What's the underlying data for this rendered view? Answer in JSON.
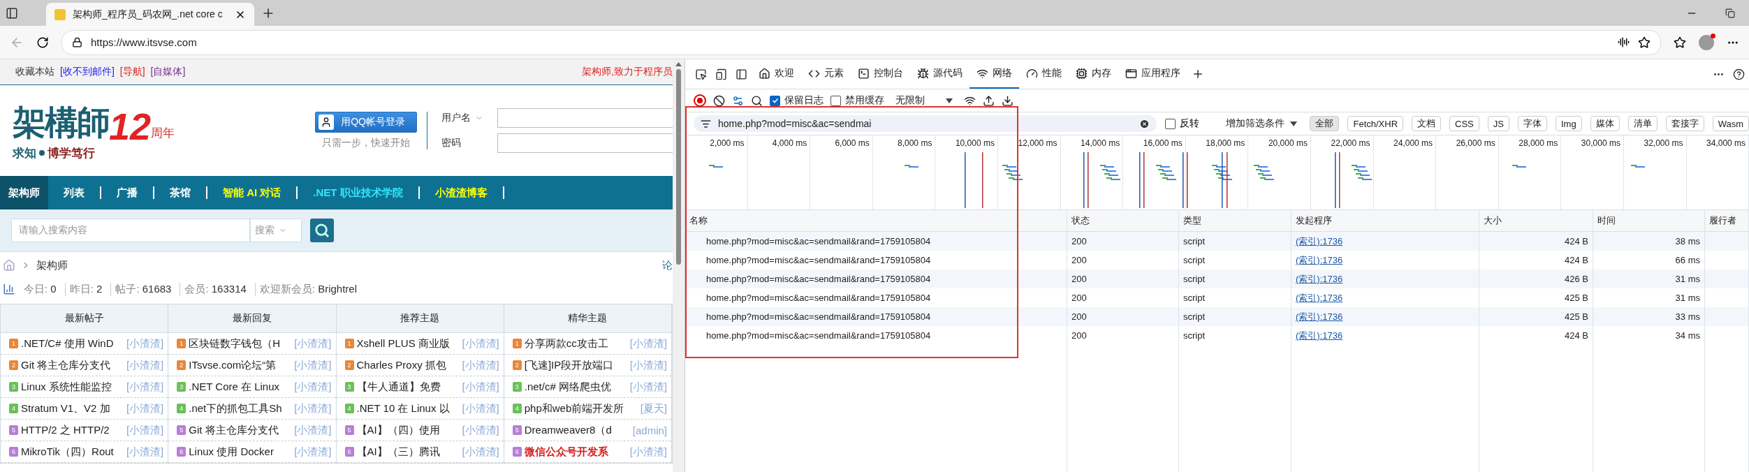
{
  "browser": {
    "tab_title": "架构师_程序员_码农网_.net core c",
    "url": "https://www.itsvse.com"
  },
  "site": {
    "top_links": [
      {
        "text": "收藏本站",
        "color": "#333333"
      },
      {
        "text": "[收不到邮件]",
        "color": "#1a1aee"
      },
      {
        "text": "[导航]",
        "color": "#e02020"
      },
      {
        "text": "[自媒体]",
        "color": "#7a2a8a"
      }
    ],
    "slogan": "架构师,致力于程序员",
    "logo": {
      "name": "架構師",
      "number": "12",
      "suffix": "周年",
      "motto_1": "求知",
      "motto_2": "博学笃行"
    },
    "qq_login": "用QQ帐号登录",
    "qq_hint": "只需一步，快速开始",
    "login_fields": [
      {
        "label": "用户名",
        "dropdown": true
      },
      {
        "label": "密码",
        "dropdown": false
      }
    ],
    "nav": [
      {
        "label": "架构师",
        "selected": true,
        "color": "#ffffff"
      },
      {
        "label": "列表",
        "selected": false,
        "color": "#ffffff"
      },
      {
        "label": "广播",
        "selected": false,
        "color": "#ffffff"
      },
      {
        "label": "茶馆",
        "selected": false,
        "color": "#ffffff"
      },
      {
        "label": "智能 AI 对话",
        "selected": false,
        "color": "#ffff00"
      },
      {
        "label": ".NET 职业技术学院",
        "selected": false,
        "color": "#33e6ff"
      },
      {
        "label": "小渣渣博客",
        "selected": false,
        "color": "#ffff00"
      }
    ],
    "search": {
      "placeholder": "请输入搜索内容",
      "scope": "搜索"
    },
    "breadcrumb": "架构师",
    "breadcrumb_right": "论",
    "stats": [
      {
        "label": "今日:",
        "value": "0"
      },
      {
        "label": "昨日:",
        "value": "2"
      },
      {
        "label": "帖子:",
        "value": "61683"
      },
      {
        "label": "会员:",
        "value": "163314"
      },
      {
        "label": "欢迎新会员:",
        "value": "Brightrel"
      }
    ],
    "columns": [
      {
        "title": "最新帖子",
        "items": [
          {
            "rank": "1",
            "color": "#e8873a",
            "title": ".NET/C# 使用 WinD",
            "author": "[小渣渣]",
            "emphasis": false
          },
          {
            "rank": "2",
            "color": "#e8873a",
            "title": "Git 将主仓库分支代",
            "author": "[小渣渣]",
            "emphasis": false
          },
          {
            "rank": "3",
            "color": "#6cbf5a",
            "title": "Linux 系统性能监控",
            "author": "[小渣渣]",
            "emphasis": false
          },
          {
            "rank": "4",
            "color": "#6cbf5a",
            "title": "Stratum V1、V2 加",
            "author": "[小渣渣]",
            "emphasis": false
          },
          {
            "rank": "5",
            "color": "#b77ed6",
            "title": "HTTP/2 之 HTTP/2",
            "author": "[小渣渣]",
            "emphasis": false
          },
          {
            "rank": "6",
            "color": "#b77ed6",
            "title": "MikroTik（四）Rout",
            "author": "[小渣渣]",
            "emphasis": false
          }
        ]
      },
      {
        "title": "最新回复",
        "items": [
          {
            "rank": "1",
            "color": "#e8873a",
            "title": "区块链数字钱包（H",
            "author": "[小渣渣]",
            "emphasis": false
          },
          {
            "rank": "2",
            "color": "#e8873a",
            "title": "ITsvse.com论坛“第",
            "author": "[小渣渣]",
            "emphasis": false
          },
          {
            "rank": "3",
            "color": "#6cbf5a",
            "title": ".NET Core 在 Linux",
            "author": "[小渣渣]",
            "emphasis": false
          },
          {
            "rank": "4",
            "color": "#6cbf5a",
            "title": ".net下的抓包工具Sh",
            "author": "[小渣渣]",
            "emphasis": false
          },
          {
            "rank": "5",
            "color": "#b77ed6",
            "title": "Git 将主仓库分支代",
            "author": "[小渣渣]",
            "emphasis": false
          },
          {
            "rank": "6",
            "color": "#b77ed6",
            "title": "Linux 使用 Docker",
            "author": "[小渣渣]",
            "emphasis": false
          }
        ]
      },
      {
        "title": "推荐主题",
        "items": [
          {
            "rank": "1",
            "color": "#e8873a",
            "title": "Xshell PLUS 商业版",
            "author": "[小渣渣]",
            "emphasis": false
          },
          {
            "rank": "2",
            "color": "#e8873a",
            "title": "Charles Proxy 抓包",
            "author": "[小渣渣]",
            "emphasis": false
          },
          {
            "rank": "3",
            "color": "#6cbf5a",
            "title": "【牛人通道】免费",
            "author": "[小渣渣]",
            "emphasis": false
          },
          {
            "rank": "4",
            "color": "#6cbf5a",
            "title": ".NET 10 在 Linux 以",
            "author": "[小渣渣]",
            "emphasis": false
          },
          {
            "rank": "5",
            "color": "#b77ed6",
            "title": "【AI】（四）使用",
            "author": "[小渣渣]",
            "emphasis": false
          },
          {
            "rank": "6",
            "color": "#b77ed6",
            "title": "【AI】（三）腾讯",
            "author": "[小渣渣]",
            "emphasis": false
          }
        ]
      },
      {
        "title": "精华主题",
        "items": [
          {
            "rank": "1",
            "color": "#e8873a",
            "title": "分享两款cc攻击工",
            "author": "[小渣渣]",
            "emphasis": false
          },
          {
            "rank": "2",
            "color": "#e8873a",
            "title": "[飞速]IP段开放端口",
            "author": "[小渣渣]",
            "emphasis": false
          },
          {
            "rank": "3",
            "color": "#6cbf5a",
            "title": ".net/c# 网络爬虫优",
            "author": "[小渣渣]",
            "emphasis": false
          },
          {
            "rank": "4",
            "color": "#6cbf5a",
            "title": "php和web前端开发所",
            "author": "[夏天]",
            "emphasis": false
          },
          {
            "rank": "5",
            "color": "#b77ed6",
            "title": "Dreamweaver8（d",
            "author": "[admin]",
            "emphasis": false
          },
          {
            "rank": "6",
            "color": "#b77ed6",
            "title": "微信公众号开发系",
            "author": "[小渣渣]",
            "emphasis": true
          }
        ]
      }
    ]
  },
  "devtools": {
    "tabs": [
      {
        "label": "欢迎",
        "kind": "home",
        "selected": false
      },
      {
        "label": "元素",
        "kind": "code",
        "selected": false
      },
      {
        "label": "控制台",
        "kind": "console",
        "selected": false
      },
      {
        "label": "源代码",
        "kind": "bug",
        "selected": false
      },
      {
        "label": "网络",
        "kind": "wifi",
        "selected": true
      },
      {
        "label": "性能",
        "kind": "gauge",
        "selected": false
      },
      {
        "label": "内存",
        "kind": "chip",
        "selected": false
      },
      {
        "label": "应用程序",
        "kind": "window",
        "selected": false
      }
    ],
    "preserve_log": {
      "label": "保留日志",
      "checked": true
    },
    "disable_cache": {
      "label": "禁用缓存",
      "checked": false
    },
    "throttle": "无限制",
    "filter": {
      "value": "home.php?mod=misc&ac=sendmai",
      "invert": {
        "label": "反转",
        "checked": false
      },
      "more": "增加筛选条件",
      "types": [
        {
          "label": "全部",
          "selected": true
        },
        {
          "label": "Fetch/XHR",
          "selected": false
        },
        {
          "label": "文档",
          "selected": false
        },
        {
          "label": "CSS",
          "selected": false
        },
        {
          "label": "JS",
          "selected": false
        },
        {
          "label": "字体",
          "selected": false
        },
        {
          "label": "Img",
          "selected": false
        },
        {
          "label": "媒体",
          "selected": false
        },
        {
          "label": "清单",
          "selected": false
        },
        {
          "label": "套接字",
          "selected": false
        },
        {
          "label": "Wasm",
          "selected": false
        }
      ]
    },
    "ticks": [
      "2,000 ms",
      "4,000 ms",
      "6,000 ms",
      "8,000 ms",
      "10,000 ms",
      "12,000 ms",
      "14,000 ms",
      "16,000 ms",
      "18,000 ms",
      "20,000 ms",
      "22,000 ms",
      "24,000 ms",
      "26,000 ms",
      "28,000 ms",
      "30,000 ms",
      "32,000 ms",
      "34,000 ms"
    ],
    "columns": [
      "名称",
      "状态",
      "类型",
      "发起程序",
      "大小",
      "时间",
      "履行者"
    ],
    "rows": [
      {
        "name": "home.php?mod=misc&ac=sendmail&rand=1759105804",
        "status": "200",
        "type": "script",
        "initiator": "(索引):1736",
        "size": "424 B",
        "time": "38 ms"
      },
      {
        "name": "home.php?mod=misc&ac=sendmail&rand=1759105804",
        "status": "200",
        "type": "script",
        "initiator": "(索引):1736",
        "size": "424 B",
        "time": "66 ms"
      },
      {
        "name": "home.php?mod=misc&ac=sendmail&rand=1759105804",
        "status": "200",
        "type": "script",
        "initiator": "(索引):1736",
        "size": "426 B",
        "time": "31 ms"
      },
      {
        "name": "home.php?mod=misc&ac=sendmail&rand=1759105804",
        "status": "200",
        "type": "script",
        "initiator": "(索引):1736",
        "size": "425 B",
        "time": "31 ms"
      },
      {
        "name": "home.php?mod=misc&ac=sendmail&rand=1759105804",
        "status": "200",
        "type": "script",
        "initiator": "(索引):1736",
        "size": "425 B",
        "time": "33 ms"
      },
      {
        "name": "home.php?mod=misc&ac=sendmail&rand=1759105804",
        "status": "200",
        "type": "script",
        "initiator": "(索引):1736",
        "size": "424 B",
        "time": "34 ms"
      }
    ]
  }
}
